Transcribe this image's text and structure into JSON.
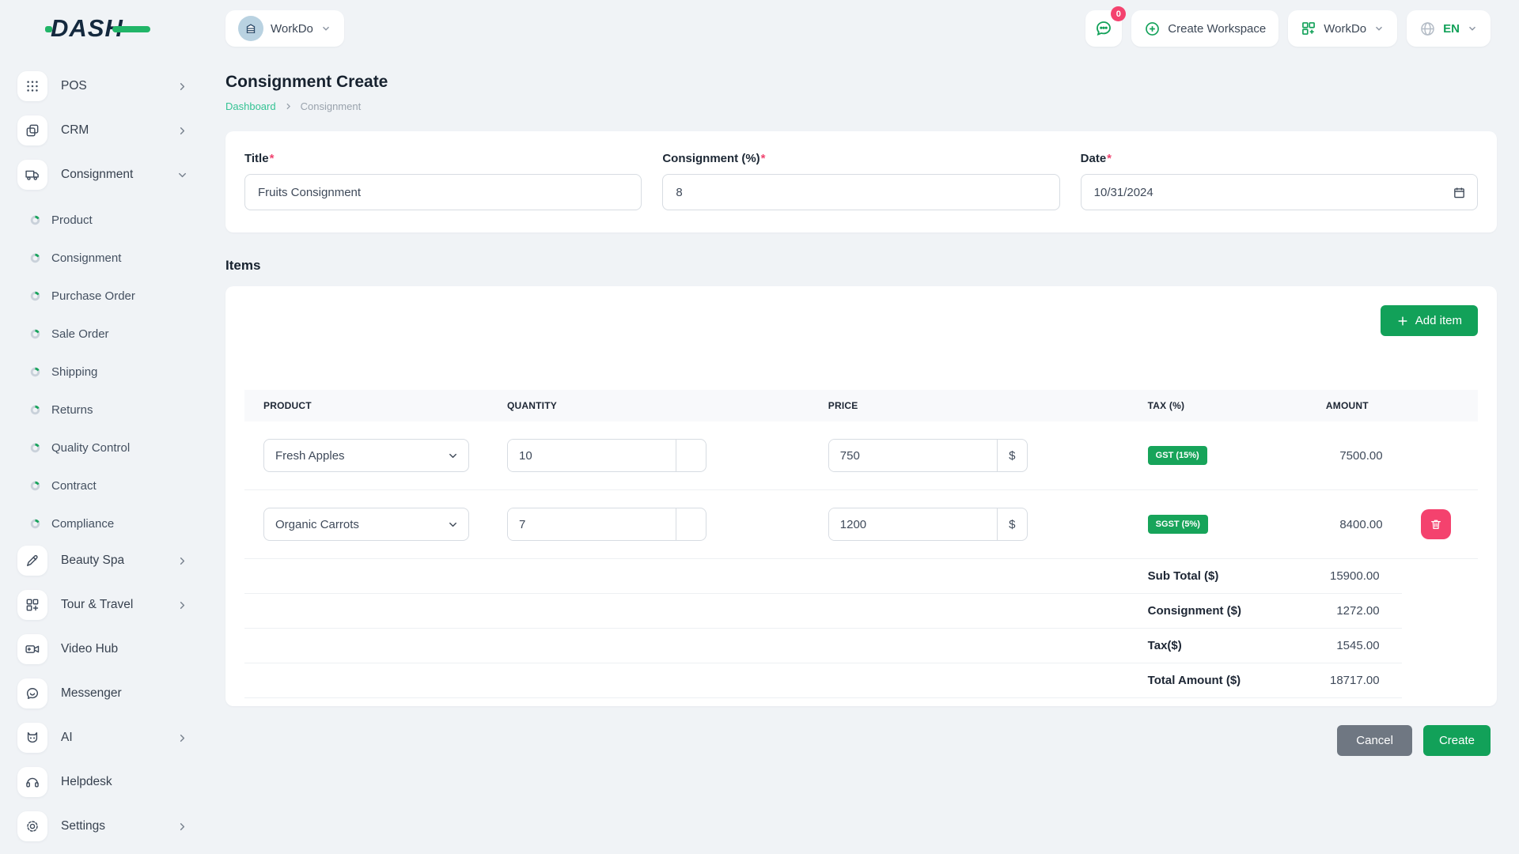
{
  "brand": {
    "logo_text": "DASH"
  },
  "topbar": {
    "workspace_switcher": {
      "label": "WorkDo"
    },
    "messages_badge": "0",
    "create_workspace_label": "Create Workspace",
    "user_menu_label": "WorkDo",
    "language": "EN"
  },
  "sidebar": {
    "items": [
      {
        "label": "POS",
        "icon": "grid-dots",
        "chevron": "right"
      },
      {
        "label": "CRM",
        "icon": "copy-squares",
        "chevron": "right"
      },
      {
        "label": "Consignment",
        "icon": "truck",
        "chevron": "down",
        "expanded": true,
        "children": [
          "Product",
          "Consignment",
          "Purchase Order",
          "Sale Order",
          "Shipping",
          "Returns",
          "Quality Control",
          "Contract",
          "Compliance"
        ]
      },
      {
        "label": "Beauty Spa",
        "icon": "brush",
        "chevron": "right"
      },
      {
        "label": "Tour & Travel",
        "icon": "grid-plus",
        "chevron": "right"
      },
      {
        "label": "Video Hub",
        "icon": "video-camera",
        "chevron": "none"
      },
      {
        "label": "Messenger",
        "icon": "chat-bubble",
        "chevron": "none"
      },
      {
        "label": "AI",
        "icon": "bot",
        "chevron": "right"
      },
      {
        "label": "Helpdesk",
        "icon": "headset",
        "chevron": "none"
      },
      {
        "label": "Settings",
        "icon": "gear",
        "chevron": "right"
      }
    ]
  },
  "page": {
    "title": "Consignment Create",
    "breadcrumb": {
      "link": "Dashboard",
      "current": "Consignment"
    }
  },
  "form": {
    "required_mark": "*",
    "fields": [
      {
        "label": "Title",
        "value": "Fruits Consignment"
      },
      {
        "label": "Consignment (%)",
        "value": "8"
      },
      {
        "label": "Date",
        "value": "10/31/2024"
      }
    ]
  },
  "items": {
    "heading": "Items",
    "add_button_label": "Add item",
    "table": {
      "headers": [
        "PRODUCT",
        "QUANTITY",
        "PRICE",
        "TAX (%)",
        "AMOUNT"
      ],
      "rows": [
        {
          "product": "Fresh Apples",
          "quantity": "10",
          "price": "750",
          "currency": "$",
          "tax": "GST (15%)",
          "amount": "7500.00",
          "deletable": false
        },
        {
          "product": "Organic Carrots",
          "quantity": "7",
          "price": "1200",
          "currency": "$",
          "tax": "SGST (5%)",
          "amount": "8400.00",
          "deletable": true
        }
      ],
      "summary": [
        {
          "label": "Sub Total ($)",
          "value": "15900.00"
        },
        {
          "label": "Consignment ($)",
          "value": "1272.00"
        },
        {
          "label": "Tax($)",
          "value": "1545.00"
        },
        {
          "label": "Total Amount ($)",
          "value": "18717.00"
        }
      ]
    }
  },
  "footer": {
    "cancel_label": "Cancel",
    "create_label": "Create"
  },
  "colors": {
    "primary_green": "#12a159",
    "badge_green": "#17a45a",
    "danger_pink": "#f4426e",
    "breadcrumb_link": "#35c394",
    "logo_navy": "#14293e",
    "logo_green": "#21b568",
    "page_bg": "#f0f3f6"
  }
}
